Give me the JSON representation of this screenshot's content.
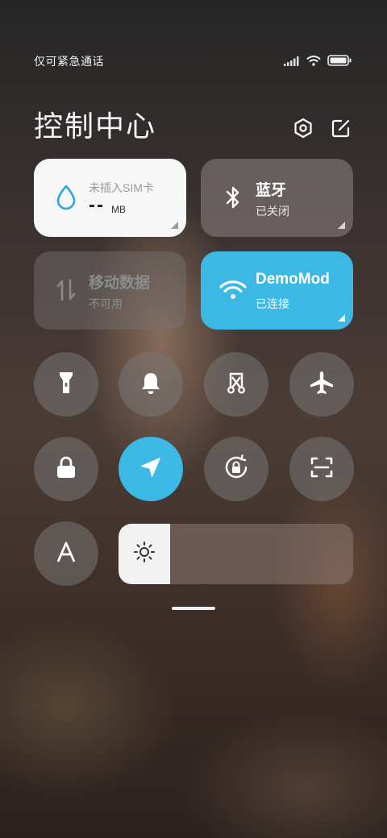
{
  "status_bar": {
    "carrier_text": "仅可紧急通话",
    "icons": [
      "signal-icon",
      "wifi-icon",
      "battery-icon"
    ]
  },
  "header": {
    "title": "控制中心",
    "icons": [
      "settings-hex-icon",
      "edit-icon"
    ]
  },
  "tiles": {
    "data_usage": {
      "subtitle": "未插入SIM卡",
      "value": "--",
      "unit": "MB",
      "icon": "droplet-icon"
    },
    "bluetooth": {
      "label": "蓝牙",
      "status": "已关闭",
      "icon": "bluetooth-icon"
    },
    "mobile_data": {
      "label": "移动数据",
      "status": "不可用",
      "icon": "mobile-data-arrows-icon"
    },
    "wifi": {
      "label": "DemoMod",
      "status": "已连接",
      "icon": "wifi-icon"
    }
  },
  "toggles": [
    {
      "name": "flashlight",
      "icon": "flashlight-icon",
      "active": false
    },
    {
      "name": "silent",
      "icon": "bell-icon",
      "active": false
    },
    {
      "name": "screenshot",
      "icon": "scissors-screenshot-icon",
      "active": false
    },
    {
      "name": "airplane",
      "icon": "airplane-icon",
      "active": false
    },
    {
      "name": "lock-screen",
      "icon": "lock-icon",
      "active": false
    },
    {
      "name": "location",
      "icon": "location-arrow-icon",
      "active": true
    },
    {
      "name": "rotation-lock",
      "icon": "rotation-lock-icon",
      "active": false
    },
    {
      "name": "scan",
      "icon": "scan-icon",
      "active": false
    },
    {
      "name": "font-size",
      "icon": "font-a-icon",
      "active": false
    }
  ],
  "brightness": {
    "level_percent": 22,
    "icon": "sun-icon"
  },
  "colors": {
    "accent": "#3bb8e4",
    "tile_light": "#f5f5f5",
    "tile_dim": "rgba(150,140,140,0.5)"
  }
}
